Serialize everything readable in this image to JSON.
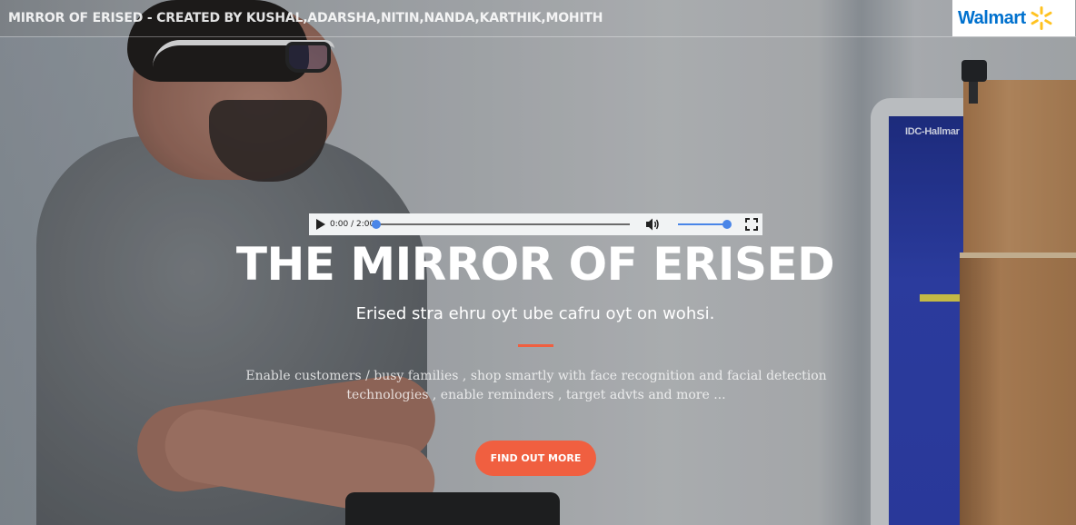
{
  "nav": {
    "brand": "MIRROR OF ERISED - CREATED BY KUSHAL,ADARSHA,NITIN,NANDA,KARTHIK,MOHITH",
    "logo_text": "Walmart",
    "logo_color": "#0071ce",
    "spark_color": "#ffc220"
  },
  "audio": {
    "time": "0:00 / 2:00",
    "progress": 0.0,
    "volume": 1.0,
    "icons": [
      "play-icon",
      "volume-icon",
      "fullscreen-icon"
    ]
  },
  "hero": {
    "title": "THE MIRROR OF ERISED",
    "subtitle": "Erised stra ehru oyt ube cafru oyt on wohsi.",
    "description": "Enable customers / busy families , shop smartly with face recognition and facial detection technologies , enable reminders , target advts and more ...",
    "cta_label": "FIND OUT MORE",
    "accent": "#f05f40"
  },
  "background": {
    "monitor_text": "IDC-Hallmar"
  }
}
